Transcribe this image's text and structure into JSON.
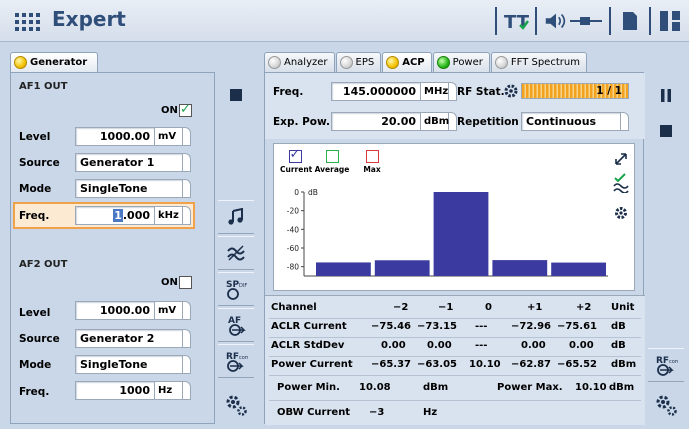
{
  "header": {
    "title": "Expert"
  },
  "left": {
    "tabs": [
      {
        "label": "Generator",
        "led": "yellow"
      }
    ],
    "af1": {
      "title": "AF1 OUT",
      "on_label": "ON",
      "on_checked": true,
      "level_label": "Level",
      "level_value": "1000.00",
      "level_unit": "mV",
      "source_label": "Source",
      "source_value": "Generator 1",
      "mode_label": "Mode",
      "mode_value": "SingleTone",
      "freq_label": "Freq.",
      "freq_cursor": "1",
      "freq_rest": ".000",
      "freq_unit": "kHz"
    },
    "af2": {
      "title": "AF2 OUT",
      "on_label": "ON",
      "on_checked": false,
      "level_label": "Level",
      "level_value": "1000.00",
      "level_unit": "mV",
      "source_label": "Source",
      "source_value": "Generator 2",
      "mode_label": "Mode",
      "mode_value": "SingleTone",
      "freq_label": "Freq.",
      "freq_value": "1000",
      "freq_unit": "Hz"
    }
  },
  "right": {
    "tabs": [
      {
        "label": "Analyzer",
        "led": "gray",
        "active": false
      },
      {
        "label": "EPS",
        "led": "gray",
        "active": false
      },
      {
        "label": "ACP",
        "led": "yellow",
        "active": true
      },
      {
        "label": "Power",
        "led": "green",
        "active": false
      },
      {
        "label": "FFT Spectrum",
        "led": "gray",
        "active": false
      }
    ],
    "freq_label": "Freq.",
    "freq_value": "145.000000",
    "freq_unit": "MHz",
    "rfstat_label": "RF Stat.",
    "rfstat_value": "1 / 1",
    "exppow_label": "Exp. Pow.",
    "exppow_value": "20.00",
    "exppow_unit": "dBm",
    "repetition_label": "Repetition",
    "repetition_value": "Continuous",
    "legend": [
      {
        "label": "Current",
        "color": "#3a3aa0",
        "checked": true
      },
      {
        "label": "Average",
        "color": "#2db34a",
        "checked": false
      },
      {
        "label": "Max",
        "color": "#d23c3c",
        "checked": false
      }
    ],
    "chart_unit_label": "dB",
    "results": {
      "header": [
        "Channel",
        "−2",
        "−1",
        "0",
        "+1",
        "+2",
        "Unit"
      ],
      "aclr_current": [
        "ACLR  Current",
        "−75.46",
        "−73.15",
        "---",
        "−72.96",
        "−75.61",
        "dB"
      ],
      "aclr_stddev": [
        "ACLR  StdDev",
        "0.00",
        "0.00",
        "---",
        "0.00",
        "0.00",
        "dB"
      ],
      "power_current": [
        "Power Current",
        "−65.37",
        "−63.05",
        "10.10",
        "−62.87",
        "−65.52",
        "dBm"
      ],
      "power_min_label": "Power Min.",
      "power_min_value": "10.08",
      "power_min_unit": "dBm",
      "power_max_label": "Power Max.",
      "power_max_value": "10.10",
      "power_max_unit": "dBm",
      "obw_label": "OBW Current",
      "obw_value": "−3",
      "obw_unit": "Hz"
    }
  },
  "chart_data": {
    "type": "bar",
    "categories": [
      "−2",
      "−1",
      "0",
      "+1",
      "+2"
    ],
    "series": [
      {
        "name": "Current",
        "values": [
          -75.46,
          -73.15,
          0,
          -72.96,
          -75.61
        ]
      }
    ],
    "ylabel": "dB",
    "y_ticks": [
      "0",
      "-20",
      "-40",
      "-60",
      "-80"
    ],
    "ylim": [
      -90,
      0
    ],
    "colors": {
      "Current": "#3a3aa0"
    }
  },
  "colors": {
    "accent": "#2f4f7a",
    "background": "#c9d7e8",
    "focus": "#f0a24a",
    "bar": "#3a3aa0"
  }
}
